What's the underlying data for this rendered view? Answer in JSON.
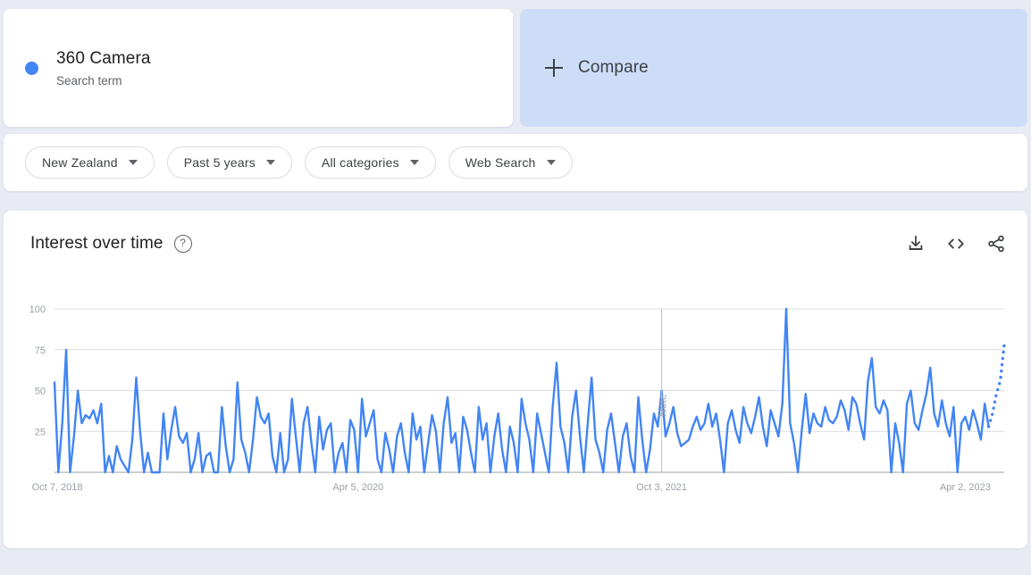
{
  "term_card": {
    "title": "360 Camera",
    "subtitle": "Search term",
    "dot_color": "#4285f4"
  },
  "compare": {
    "label": "Compare",
    "plus_icon": "plus-icon",
    "background": "#cdddf7"
  },
  "filters": [
    {
      "label": "New Zealand"
    },
    {
      "label": "Past 5 years"
    },
    {
      "label": "All categories"
    },
    {
      "label": "Web Search"
    }
  ],
  "chart_card": {
    "title": "Interest over time",
    "help_icon": "question-mark-icon",
    "actions": [
      {
        "name": "download-icon"
      },
      {
        "name": "embed-code-icon"
      },
      {
        "name": "share-icon"
      }
    ]
  },
  "chart_data": {
    "type": "line",
    "title": "Interest over time",
    "xlabel": "",
    "ylabel": "",
    "ylim": [
      0,
      100
    ],
    "grid": true,
    "legend": null,
    "line_color": "#4285f4",
    "y_ticks": [
      25,
      50,
      75,
      100
    ],
    "x_tick_labels": [
      "Oct 7, 2018",
      "Apr 5, 2020",
      "Oct 3, 2021",
      "Apr 2, 2023"
    ],
    "x_tick_indices": [
      0,
      78,
      156,
      234
    ],
    "annotation": {
      "text": "Note",
      "x_index": 156,
      "orientation": "vertical"
    },
    "partial_data_tail_points": 4,
    "series_name": "360 Camera",
    "values": [
      55,
      0,
      30,
      75,
      0,
      22,
      50,
      30,
      35,
      33,
      38,
      30,
      42,
      0,
      10,
      0,
      16,
      8,
      4,
      0,
      20,
      58,
      25,
      0,
      12,
      0,
      0,
      0,
      36,
      8,
      26,
      40,
      22,
      18,
      24,
      0,
      8,
      24,
      0,
      10,
      12,
      0,
      0,
      40,
      16,
      0,
      8,
      55,
      20,
      12,
      0,
      20,
      46,
      34,
      30,
      36,
      10,
      0,
      24,
      0,
      8,
      45,
      22,
      0,
      30,
      40,
      18,
      0,
      34,
      14,
      26,
      30,
      0,
      12,
      18,
      0,
      32,
      26,
      0,
      45,
      22,
      30,
      38,
      8,
      0,
      24,
      14,
      0,
      22,
      30,
      12,
      0,
      36,
      20,
      28,
      0,
      18,
      35,
      25,
      0,
      30,
      46,
      18,
      24,
      0,
      34,
      26,
      12,
      0,
      40,
      20,
      30,
      0,
      22,
      36,
      14,
      0,
      28,
      18,
      0,
      45,
      30,
      20,
      0,
      36,
      24,
      12,
      0,
      40,
      67,
      28,
      18,
      0,
      34,
      50,
      22,
      0,
      30,
      58,
      20,
      12,
      0,
      26,
      36,
      18,
      0,
      22,
      30,
      10,
      0,
      46,
      20,
      0,
      14,
      36,
      28,
      50,
      22,
      30,
      40,
      24,
      16,
      18,
      20,
      28,
      34,
      26,
      30,
      42,
      28,
      36,
      20,
      0,
      30,
      38,
      26,
      18,
      40,
      30,
      24,
      34,
      46,
      28,
      16,
      38,
      30,
      22,
      42,
      100,
      30,
      18,
      0,
      26,
      48,
      24,
      36,
      30,
      28,
      40,
      32,
      30,
      34,
      44,
      38,
      26,
      46,
      42,
      30,
      20,
      56,
      70,
      40,
      36,
      44,
      38,
      0,
      30,
      18,
      0,
      42,
      50,
      30,
      26,
      38,
      48,
      64,
      36,
      28,
      44,
      30,
      22,
      40,
      0,
      30,
      34,
      26,
      38,
      30,
      20,
      42,
      28,
      36,
      48,
      56,
      78
    ]
  }
}
